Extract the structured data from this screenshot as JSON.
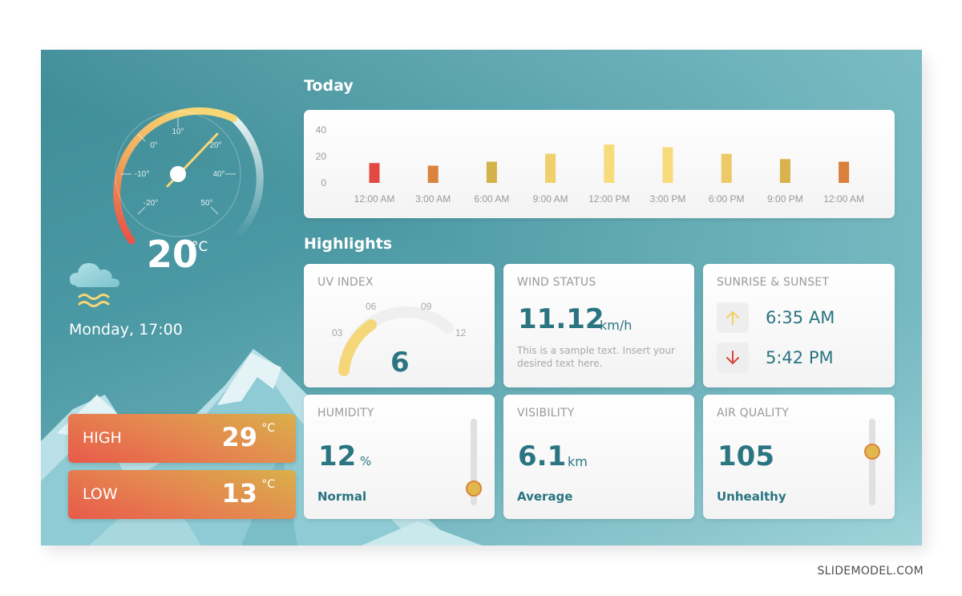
{
  "current": {
    "temperature": "20",
    "unit": "°C",
    "date_time": "Monday, 17:00",
    "weather_icon": "cloud-fog-icon",
    "gauge_value": 20,
    "gauge_labels": [
      "-20°",
      "-10°",
      "0°",
      "10°",
      "20°",
      "40°",
      "50°"
    ]
  },
  "high": {
    "label": "HIGH",
    "value": "29",
    "unit": "°C"
  },
  "low": {
    "label": "LOW",
    "value": "13",
    "unit": "°C"
  },
  "today": {
    "title": "Today"
  },
  "chart_data": {
    "type": "bar",
    "title": "Today",
    "categories": [
      "12:00 AM",
      "3:00 AM",
      "6:00 AM",
      "9:00 AM",
      "12:00 PM",
      "3:00 PM",
      "6:00 PM",
      "9:00 PM",
      "12:00 AM"
    ],
    "values": [
      15,
      13,
      16,
      22,
      29,
      27,
      22,
      18,
      16
    ],
    "colors": [
      "#e04a43",
      "#d9833c",
      "#d4b24a",
      "#efcf6e",
      "#f7dc7e",
      "#f7dc7e",
      "#ecca6a",
      "#d8b24a",
      "#d9803c"
    ],
    "yticks": [
      0,
      20,
      40
    ],
    "ylim": [
      0,
      40
    ],
    "xlabel": "",
    "ylabel": "",
    "grid": false
  },
  "highlights": {
    "title": "Highlights",
    "uv": {
      "title": "UV INDEX",
      "value": "6",
      "value_num": 6,
      "max": 12,
      "ticks": [
        "03",
        "06",
        "09",
        "12"
      ]
    },
    "wind": {
      "title": "WIND STATUS",
      "value": "11.12",
      "unit": "km/h",
      "note": "This is a sample text. Insert your desired text here."
    },
    "sun": {
      "title": "SUNRISE & SUNSET",
      "sunrise": "6:35 AM",
      "sunset": "5:42 PM"
    },
    "humidity": {
      "title": "HUMIDITY",
      "value": "12",
      "unit": "%",
      "status": "Normal",
      "level": 0.12
    },
    "visibility": {
      "title": "VISIBILITY",
      "value": "6.1",
      "unit": "km",
      "status": "Average"
    },
    "air": {
      "title": "AIR QUALITY",
      "value": "105",
      "status": "Unhealthy",
      "level": 0.65
    }
  },
  "colors": {
    "accent": "#2a7581",
    "warm": "#e58650",
    "yellow": "#f5d77a"
  },
  "footer": "SLIDEMODEL.COM"
}
